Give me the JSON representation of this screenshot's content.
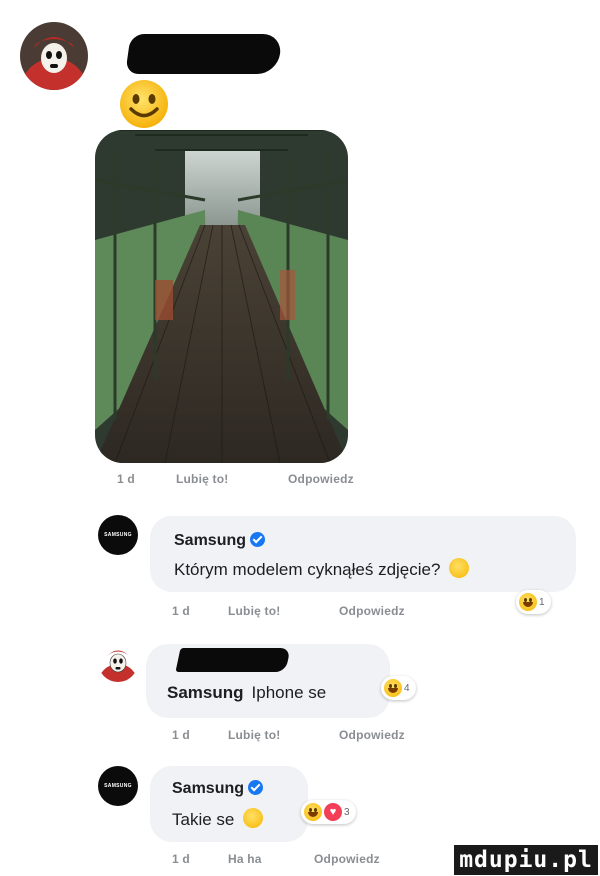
{
  "post": {
    "meta": {
      "time": "1 d",
      "like": "Lubię to!",
      "reply": "Odpowiedz"
    },
    "emoji": "smiley-face"
  },
  "comments": [
    {
      "author": "Samsung",
      "avatar_text": "SAMSUNG",
      "text": "Którym modelem cyknąłeś zdjęcie?",
      "reaction_count": "1",
      "meta": {
        "time": "1 d",
        "like": "Lubię to!",
        "reply": "Odpowiedz"
      }
    },
    {
      "author_link": "Samsung",
      "text": "Iphone se",
      "reaction_count": "4",
      "meta": {
        "time": "1 d",
        "like": "Lubię to!",
        "reply": "Odpowiedz"
      }
    },
    {
      "author": "Samsung",
      "avatar_text": "SAMSUNG",
      "text": "Takie se",
      "reaction_count": "3",
      "meta": {
        "time": "1 d",
        "like": "Ha ha",
        "reply": "Odpowiedz"
      }
    }
  ],
  "watermark": "mdupiu.pl",
  "colors": {
    "bubble": "#f0f2f5",
    "meta_text": "#8a8d91",
    "verified": "#1877f2",
    "heart": "#f33e58"
  }
}
